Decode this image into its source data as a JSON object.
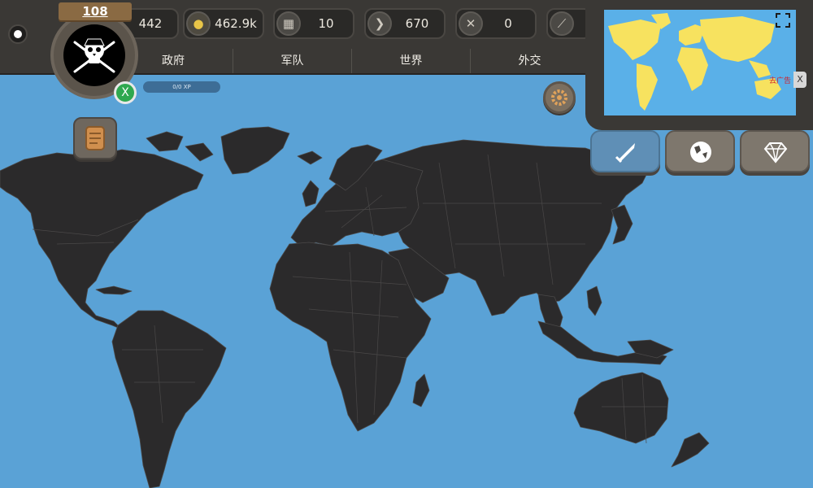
{
  "player": {
    "level": "108",
    "xp_label": "0/0 XP",
    "badge_label": "X"
  },
  "resources": [
    {
      "icon": "population-icon",
      "value": "442"
    },
    {
      "icon": "gold-coins-icon",
      "value": "462.9k"
    },
    {
      "icon": "building-icon",
      "value": "10"
    },
    {
      "icon": "horn-icon",
      "value": "670"
    },
    {
      "icon": "crossed-swords-icon",
      "value": "0"
    },
    {
      "icon": "sword-icon",
      "value": ""
    }
  ],
  "tabs": [
    "政府",
    "军队",
    "世界",
    "外交"
  ],
  "minimap": {
    "ad_label": "去广告",
    "ad_close": "X"
  },
  "mode_buttons": [
    {
      "icon": "sword-icon",
      "active": true
    },
    {
      "icon": "globe-icon",
      "active": false
    },
    {
      "icon": "diamond-icon",
      "active": false
    }
  ],
  "colors": {
    "ocean": "#5aa2d6",
    "land": "#2b2a2b",
    "border": "#4a4848",
    "panel": "#3a3835",
    "minimap_land": "#f7e25f",
    "active_button": "#5f8fb6"
  }
}
